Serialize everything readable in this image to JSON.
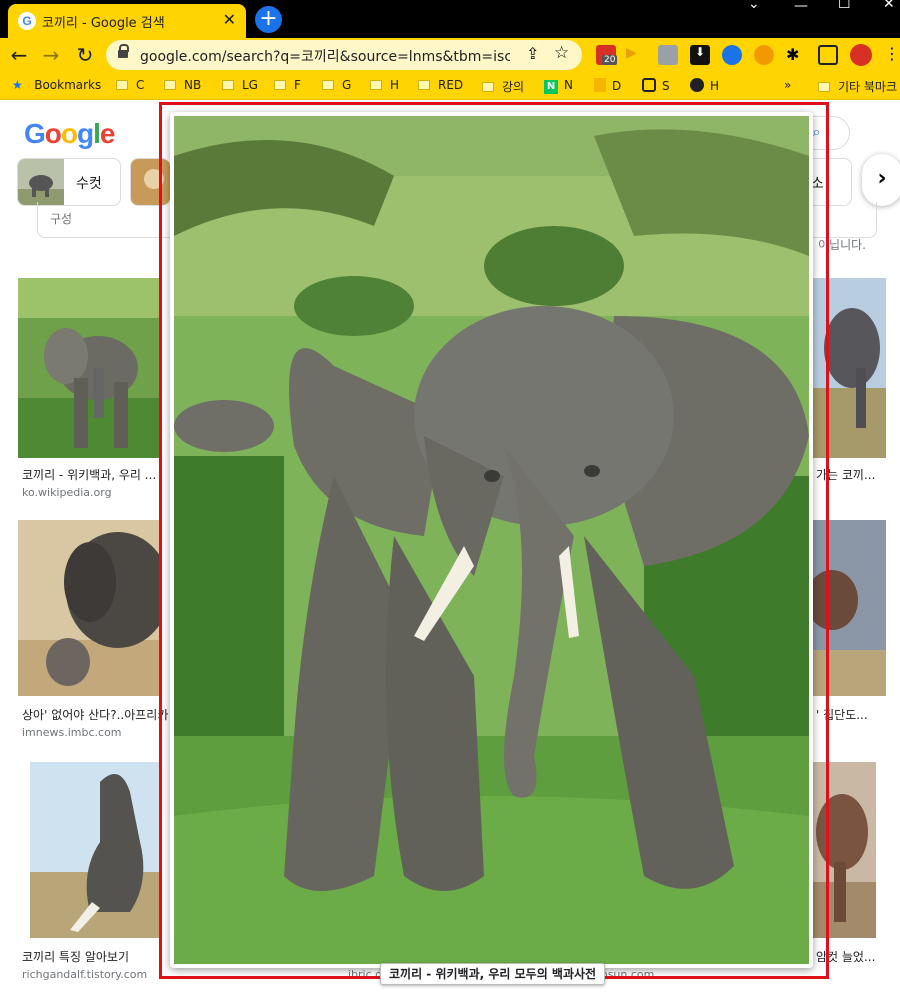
{
  "browser": {
    "tab_title": "코끼리 - Google 검색",
    "tab_close": "✕",
    "new_tab": "+",
    "window_controls": [
      "⌄",
      "—",
      "☐",
      "✕"
    ],
    "url": "google.com/search?q=코끼리&source=lnms&tbm=isch&...",
    "ext_badge": "20",
    "colors": {
      "accent": "#ffd400",
      "tabbar": "#000000"
    }
  },
  "bookmarks": [
    {
      "label": "Bookmarks",
      "icon": "star-icon"
    },
    {
      "label": "C"
    },
    {
      "label": "NB"
    },
    {
      "label": "LG"
    },
    {
      "label": "F"
    },
    {
      "label": "G"
    },
    {
      "label": "H"
    },
    {
      "label": "RED"
    },
    {
      "label": "강의"
    },
    {
      "label": "N"
    },
    {
      "label": "D"
    },
    {
      "label": "S"
    },
    {
      "label": "H"
    },
    {
      "label": "»"
    },
    {
      "label": "기타 북마크"
    }
  ],
  "page": {
    "logo": "Google",
    "chip_1_label": "수컷",
    "chip_right_fragment": "거소",
    "scroll_right": "›",
    "partial_left_text": "구성",
    "partial_right_text": "이닙니다.",
    "results": [
      {
        "caption": "코끼리 - 위키백과, 우리 ...",
        "source": "ko.wikipedia.org"
      },
      {
        "caption": "상아' 없어야 산다?..아프리카",
        "source": "imnews.imbc.com"
      },
      {
        "caption": "코끼리 특징 알아보기",
        "source": "richgandalf.tistory.com"
      },
      {
        "caption": "가는 코끼...",
        "source": ""
      },
      {
        "caption": "' 집단도...",
        "source": ""
      },
      {
        "caption": "암컷 늘었...",
        "source": ""
      }
    ],
    "under_sources": [
      "ibric.or",
      "hosun.com"
    ]
  },
  "preview": {
    "caption": "코끼리 - 위키백과, 우리 모두의 백과사전",
    "highlight_color": "#e0101a"
  }
}
